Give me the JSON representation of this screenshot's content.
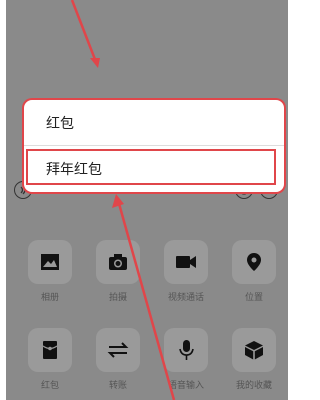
{
  "popup": {
    "items": [
      {
        "label": "红包"
      },
      {
        "label": "拜年红包"
      }
    ]
  },
  "panel": {
    "row1": [
      {
        "label": "相册",
        "icon": "image-icon"
      },
      {
        "label": "拍摄",
        "icon": "camera-icon"
      },
      {
        "label": "视频通话",
        "icon": "video-call-icon"
      },
      {
        "label": "位置",
        "icon": "location-pin-icon"
      }
    ],
    "row2": [
      {
        "label": "红包",
        "icon": "red-packet-icon"
      },
      {
        "label": "转账",
        "icon": "transfer-icon"
      },
      {
        "label": "语音输入",
        "icon": "microphone-icon"
      },
      {
        "label": "我的收藏",
        "icon": "favorites-cube-icon"
      }
    ]
  },
  "colors": {
    "overlay": "#8a8a8a",
    "annotation_red": "#e0464a",
    "popup_bg": "#ffffff"
  }
}
